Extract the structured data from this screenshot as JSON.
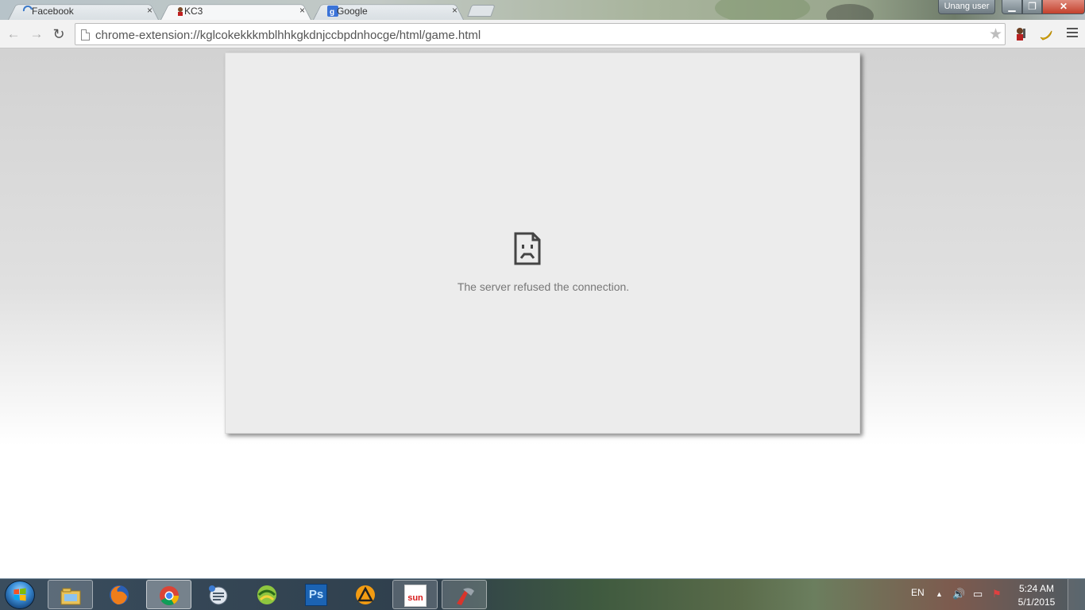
{
  "browser": {
    "tabs": [
      {
        "label": "Facebook",
        "favicon": "loading-spinner-icon",
        "close": "×",
        "active": false
      },
      {
        "label": "KC3",
        "favicon": "kc3-extension-icon",
        "close": "×",
        "active": true
      },
      {
        "label": "Google",
        "favicon": "google-icon",
        "close": "×",
        "active": false
      }
    ],
    "user_button": "Unang user",
    "window_controls": {
      "minimize": "▁",
      "maximize": "❐",
      "close": "✕"
    },
    "url": "chrome-extension://kglcokekkkmblhhkgkdnjccbpdnhocge/html/game.html",
    "nav": {
      "back": "←",
      "forward": "→",
      "reload": "↻",
      "star": "★"
    },
    "extensions": [
      "kc3-extension-icon",
      "banana-extension-icon"
    ]
  },
  "page": {
    "error_icon": "sad-document-icon",
    "error_message": "The server refused the connection."
  },
  "taskbar": {
    "pinned": [
      "windows-explorer-icon",
      "firefox-icon",
      "chrome-icon",
      "network-tool-icon",
      "game-client-icon",
      "photoshop-icon",
      "aimp-icon",
      "sun-broadband-icon",
      "ccleaner-icon"
    ],
    "photoshop_label": "Ps",
    "sun_label": "sun",
    "language": "EN",
    "tray": {
      "expand": "▲",
      "volume": "🔊",
      "network": "▭",
      "flag": "⚑"
    },
    "clock_time": "5:24 AM",
    "clock_date": "5/1/2015"
  },
  "colors": {
    "page_gradient_top": "#d2d2d2",
    "game_frame_bg": "#ececec",
    "close_button_red": "#c3412d",
    "photoshop_blue": "#1b63b3"
  }
}
